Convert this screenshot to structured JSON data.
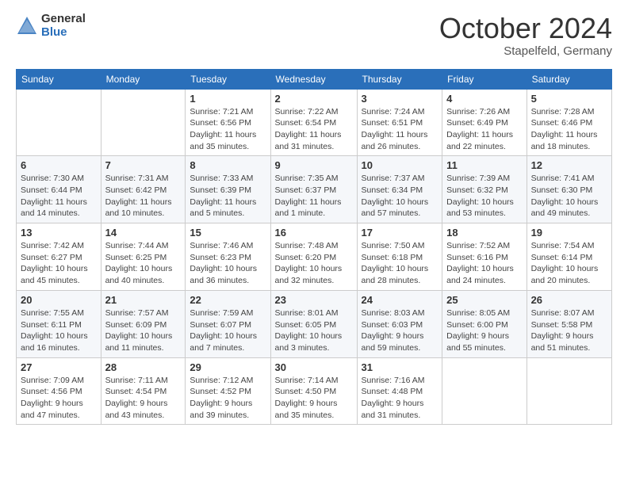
{
  "logo": {
    "general": "General",
    "blue": "Blue"
  },
  "title": "October 2024",
  "location": "Stapelfeld, Germany",
  "days_header": [
    "Sunday",
    "Monday",
    "Tuesday",
    "Wednesday",
    "Thursday",
    "Friday",
    "Saturday"
  ],
  "weeks": [
    [
      {
        "day": "",
        "info": ""
      },
      {
        "day": "",
        "info": ""
      },
      {
        "day": "1",
        "info": "Sunrise: 7:21 AM\nSunset: 6:56 PM\nDaylight: 11 hours and 35 minutes."
      },
      {
        "day": "2",
        "info": "Sunrise: 7:22 AM\nSunset: 6:54 PM\nDaylight: 11 hours and 31 minutes."
      },
      {
        "day": "3",
        "info": "Sunrise: 7:24 AM\nSunset: 6:51 PM\nDaylight: 11 hours and 26 minutes."
      },
      {
        "day": "4",
        "info": "Sunrise: 7:26 AM\nSunset: 6:49 PM\nDaylight: 11 hours and 22 minutes."
      },
      {
        "day": "5",
        "info": "Sunrise: 7:28 AM\nSunset: 6:46 PM\nDaylight: 11 hours and 18 minutes."
      }
    ],
    [
      {
        "day": "6",
        "info": "Sunrise: 7:30 AM\nSunset: 6:44 PM\nDaylight: 11 hours and 14 minutes."
      },
      {
        "day": "7",
        "info": "Sunrise: 7:31 AM\nSunset: 6:42 PM\nDaylight: 11 hours and 10 minutes."
      },
      {
        "day": "8",
        "info": "Sunrise: 7:33 AM\nSunset: 6:39 PM\nDaylight: 11 hours and 5 minutes."
      },
      {
        "day": "9",
        "info": "Sunrise: 7:35 AM\nSunset: 6:37 PM\nDaylight: 11 hours and 1 minute."
      },
      {
        "day": "10",
        "info": "Sunrise: 7:37 AM\nSunset: 6:34 PM\nDaylight: 10 hours and 57 minutes."
      },
      {
        "day": "11",
        "info": "Sunrise: 7:39 AM\nSunset: 6:32 PM\nDaylight: 10 hours and 53 minutes."
      },
      {
        "day": "12",
        "info": "Sunrise: 7:41 AM\nSunset: 6:30 PM\nDaylight: 10 hours and 49 minutes."
      }
    ],
    [
      {
        "day": "13",
        "info": "Sunrise: 7:42 AM\nSunset: 6:27 PM\nDaylight: 10 hours and 45 minutes."
      },
      {
        "day": "14",
        "info": "Sunrise: 7:44 AM\nSunset: 6:25 PM\nDaylight: 10 hours and 40 minutes."
      },
      {
        "day": "15",
        "info": "Sunrise: 7:46 AM\nSunset: 6:23 PM\nDaylight: 10 hours and 36 minutes."
      },
      {
        "day": "16",
        "info": "Sunrise: 7:48 AM\nSunset: 6:20 PM\nDaylight: 10 hours and 32 minutes."
      },
      {
        "day": "17",
        "info": "Sunrise: 7:50 AM\nSunset: 6:18 PM\nDaylight: 10 hours and 28 minutes."
      },
      {
        "day": "18",
        "info": "Sunrise: 7:52 AM\nSunset: 6:16 PM\nDaylight: 10 hours and 24 minutes."
      },
      {
        "day": "19",
        "info": "Sunrise: 7:54 AM\nSunset: 6:14 PM\nDaylight: 10 hours and 20 minutes."
      }
    ],
    [
      {
        "day": "20",
        "info": "Sunrise: 7:55 AM\nSunset: 6:11 PM\nDaylight: 10 hours and 16 minutes."
      },
      {
        "day": "21",
        "info": "Sunrise: 7:57 AM\nSunset: 6:09 PM\nDaylight: 10 hours and 11 minutes."
      },
      {
        "day": "22",
        "info": "Sunrise: 7:59 AM\nSunset: 6:07 PM\nDaylight: 10 hours and 7 minutes."
      },
      {
        "day": "23",
        "info": "Sunrise: 8:01 AM\nSunset: 6:05 PM\nDaylight: 10 hours and 3 minutes."
      },
      {
        "day": "24",
        "info": "Sunrise: 8:03 AM\nSunset: 6:03 PM\nDaylight: 9 hours and 59 minutes."
      },
      {
        "day": "25",
        "info": "Sunrise: 8:05 AM\nSunset: 6:00 PM\nDaylight: 9 hours and 55 minutes."
      },
      {
        "day": "26",
        "info": "Sunrise: 8:07 AM\nSunset: 5:58 PM\nDaylight: 9 hours and 51 minutes."
      }
    ],
    [
      {
        "day": "27",
        "info": "Sunrise: 7:09 AM\nSunset: 4:56 PM\nDaylight: 9 hours and 47 minutes."
      },
      {
        "day": "28",
        "info": "Sunrise: 7:11 AM\nSunset: 4:54 PM\nDaylight: 9 hours and 43 minutes."
      },
      {
        "day": "29",
        "info": "Sunrise: 7:12 AM\nSunset: 4:52 PM\nDaylight: 9 hours and 39 minutes."
      },
      {
        "day": "30",
        "info": "Sunrise: 7:14 AM\nSunset: 4:50 PM\nDaylight: 9 hours and 35 minutes."
      },
      {
        "day": "31",
        "info": "Sunrise: 7:16 AM\nSunset: 4:48 PM\nDaylight: 9 hours and 31 minutes."
      },
      {
        "day": "",
        "info": ""
      },
      {
        "day": "",
        "info": ""
      }
    ]
  ]
}
